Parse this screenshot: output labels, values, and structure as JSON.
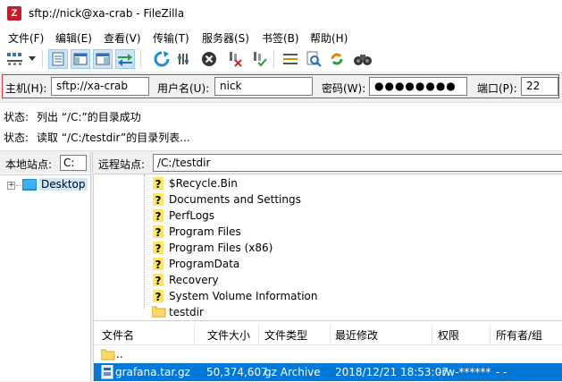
{
  "window": {
    "title": "sftp://nick@xa-crab - FileZilla",
    "app_icon_glyph": "Z"
  },
  "menu": {
    "items": [
      "文件(F)",
      "编辑(E)",
      "查看(V)",
      "传输(T)",
      "服务器(S)",
      "书签(B)",
      "帮助(H)"
    ]
  },
  "toolbar": {
    "icons": [
      "site-manager-icon",
      "dropdown-arrow-icon",
      "toggle-log-icon",
      "toggle-local-tree-icon",
      "toggle-remote-tree-icon",
      "toggle-queue-icon",
      "refresh-icon",
      "process-queue-icon",
      "cancel-icon",
      "disconnect-icon",
      "reconnect-icon",
      "directory-listing-filter-icon",
      "toggle-compare-icon",
      "synchronized-browsing-icon",
      "search-icon"
    ]
  },
  "quickconnect": {
    "host_label": "主机(H):",
    "host_value": "sftp://xa-crab",
    "user_label": "用户名(U):",
    "user_value": "nick",
    "pass_label": "密码(W):",
    "pass_value": "●●●●●●●●",
    "port_label": "端口(P):",
    "port_value": "22"
  },
  "log": [
    {
      "label": "状态:",
      "text": "列出 “/C:”的目录成功"
    },
    {
      "label": "状态:",
      "text": "读取 “/C:/testdir”的目录列表..."
    }
  ],
  "local": {
    "site_label": "本地站点:",
    "site_value": "C:",
    "tree": [
      {
        "label": "Desktop",
        "expander": "+"
      }
    ]
  },
  "remote": {
    "site_label": "远程站点:",
    "path_value": "/C:/testdir",
    "tree": [
      {
        "label": "$Recycle.Bin",
        "icon": "unknown-folder-icon"
      },
      {
        "label": "Documents and Settings",
        "icon": "unknown-folder-icon"
      },
      {
        "label": "PerfLogs",
        "icon": "unknown-folder-icon"
      },
      {
        "label": "Program Files",
        "icon": "unknown-folder-icon"
      },
      {
        "label": "Program Files (x86)",
        "icon": "unknown-folder-icon"
      },
      {
        "label": "ProgramData",
        "icon": "unknown-folder-icon"
      },
      {
        "label": "Recovery",
        "icon": "unknown-folder-icon"
      },
      {
        "label": "System Volume Information",
        "icon": "unknown-folder-icon"
      },
      {
        "label": "testdir",
        "icon": "folder-icon"
      }
    ]
  },
  "filelist": {
    "columns": [
      "文件名",
      "文件大小",
      "文件类型",
      "最近修改",
      "权限",
      "所有者/组"
    ],
    "rows": [
      {
        "name": "..",
        "size": "",
        "type": "",
        "modified": "",
        "perms": "",
        "owner": "",
        "selected": false,
        "icon": "parent-folder-icon"
      },
      {
        "name": "grafana.tar.gz",
        "size": "50,374,607",
        "type": "gz Archive",
        "modified": "2018/12/21 18:53:07",
        "perms": "-rw-******",
        "owner": "- -",
        "selected": true,
        "icon": "archive-file-icon"
      }
    ]
  },
  "colors": {
    "selection": "#0078d7",
    "quickconnect_border": "#e03030",
    "app_icon": "#bf1e2d"
  }
}
